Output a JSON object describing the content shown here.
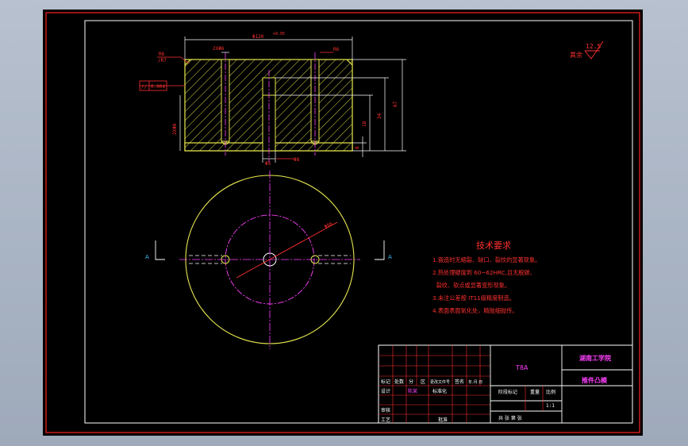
{
  "drawing": {
    "dimensions": {
      "top_diameter": "Φ120",
      "top_tolerance": "+0.05",
      "slot_width": "2XΦ6",
      "r_top_right": "R6",
      "r_top_left_1": "R6",
      "r_top_left_2": "/R7",
      "flatness": "0.004",
      "left_vertical": "2XΦ6",
      "height_67": "67",
      "height_34": "34",
      "height_18": "18",
      "height_8": "8",
      "bottom_d1": "Φ5",
      "bottom_d2": "Φ8",
      "circle_dia": "Φ66"
    },
    "surface_finish": {
      "prefix": "其余",
      "value": "12.5"
    },
    "section_marks": {
      "left": "A",
      "right": "A"
    }
  },
  "tech_requirements": {
    "title": "技术要求",
    "items": [
      "1.锻造时无缩裂、缺口、裂纹的显著现象。",
      "2.热处理硬度到 60~62HRC,且无脱碳、",
      "  裂纹、软点或显著变形现象。",
      "3.未注公差按 IT11级精度制造。",
      "4.表面表面氧化处，精抛细抛传。"
    ]
  },
  "title_block": {
    "material": "T8A",
    "school": "湖南工学院",
    "part_name": "推件凸模",
    "row_headers": [
      "标记",
      "处数",
      "分",
      "区",
      "更改文件号",
      "签名",
      "年.月.日"
    ],
    "designer_label": "设计",
    "designer_name": "陈某",
    "standard_label": "标准化",
    "stage_label": "阶段标记",
    "weight_label": "重量",
    "scale_label": "比例",
    "scale_value": "1:1",
    "review_label": "审核",
    "process_label": "工艺",
    "approve_label": "批准",
    "sheets_label": "共 张 第 张"
  }
}
